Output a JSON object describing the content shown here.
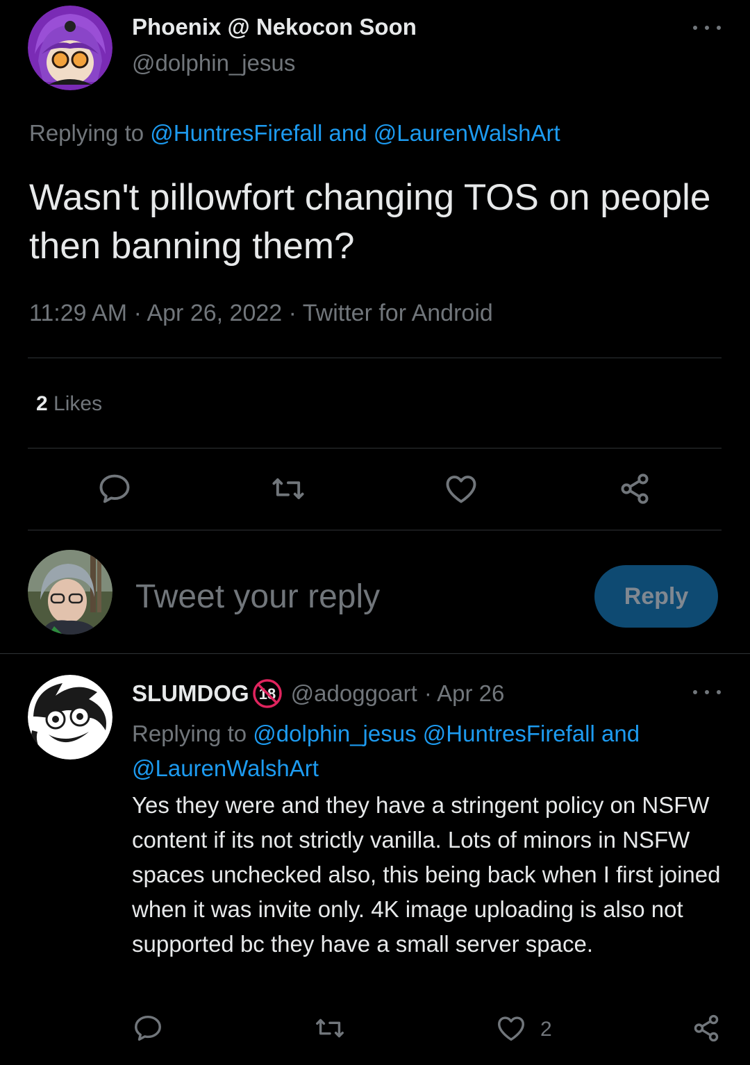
{
  "main_tweet": {
    "author_name": "Phoenix @ Nekocon Soon",
    "author_handle": "@dolphin_jesus",
    "replying_prefix": "Replying to",
    "replying_user1": "@HuntresFirefall",
    "replying_and": "and",
    "replying_user2": "@LaurenWalshArt",
    "text": "Wasn't pillowfort changing TOS on people then banning them?",
    "meta": "11:29 AM · Apr 26, 2022 · Twitter for Android",
    "likes_count": "2",
    "likes_label": "Likes"
  },
  "composer": {
    "placeholder": "Tweet your reply",
    "reply_button": "Reply"
  },
  "reply_tweet": {
    "author_name": "SLUMDOG",
    "badge": "18",
    "author_handle": "@adoggoart",
    "date": "· Apr 26",
    "replying_prefix": "Replying to",
    "replying_user1": "@dolphin_jesus",
    "replying_user2": "@HuntresFirefall",
    "replying_and": "and",
    "replying_user3": "@LaurenWalshArt",
    "text": "Yes they were and they have a stringent policy on NSFW content if its not strictly vanilla. Lots of minors in NSFW spaces unchecked also, this being back when I first joined when it was invite only. 4K image uploading is also not supported bc they have a small server space.",
    "like_count": "2"
  },
  "icons": {
    "reply": "reply-icon",
    "retweet": "retweet-icon",
    "like": "heart-icon",
    "share": "share-icon",
    "more": "more-icon"
  },
  "colors": {
    "background": "#000000",
    "link": "#1d9bf0",
    "secondary_text": "#71767b",
    "reply_button": "#0e4a72"
  }
}
